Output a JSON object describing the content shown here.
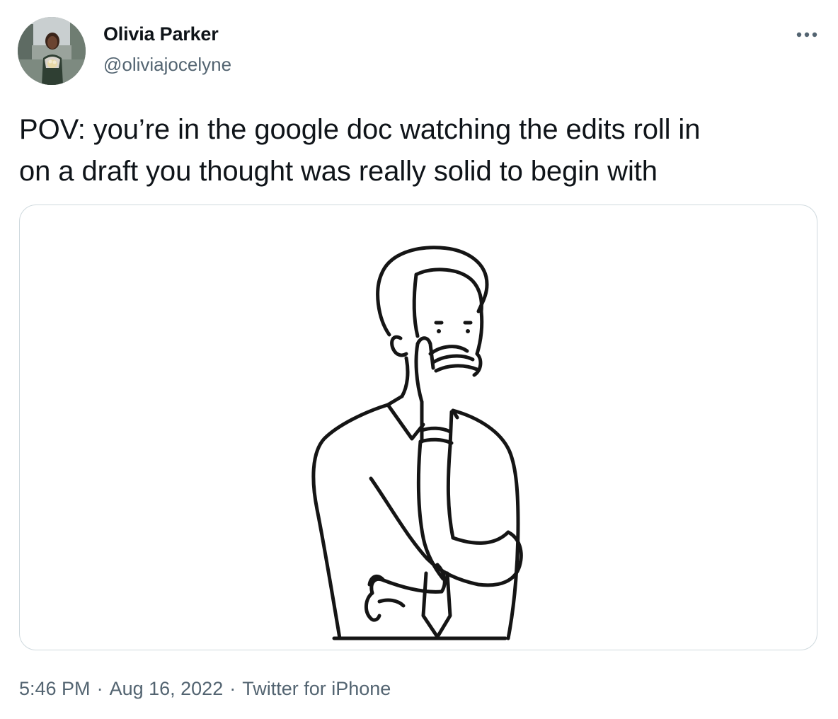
{
  "tweet": {
    "author": {
      "display_name": "Olivia Parker",
      "handle": "@oliviajocelyne"
    },
    "text_lines": [
      "POV: you’re in the google doc watching the edits roll in",
      "on a draft you thought was really solid to begin with"
    ],
    "media": {
      "icon": "thinking-man-line-drawing"
    },
    "meta": {
      "time": "5:46 PM",
      "separator": "·",
      "date": "Aug 16, 2022",
      "source": "Twitter for iPhone"
    }
  },
  "icons": {
    "more": "more-options-icon"
  },
  "colors": {
    "text_primary": "#0f1419",
    "text_secondary": "#536471",
    "border": "#cfd9de"
  }
}
